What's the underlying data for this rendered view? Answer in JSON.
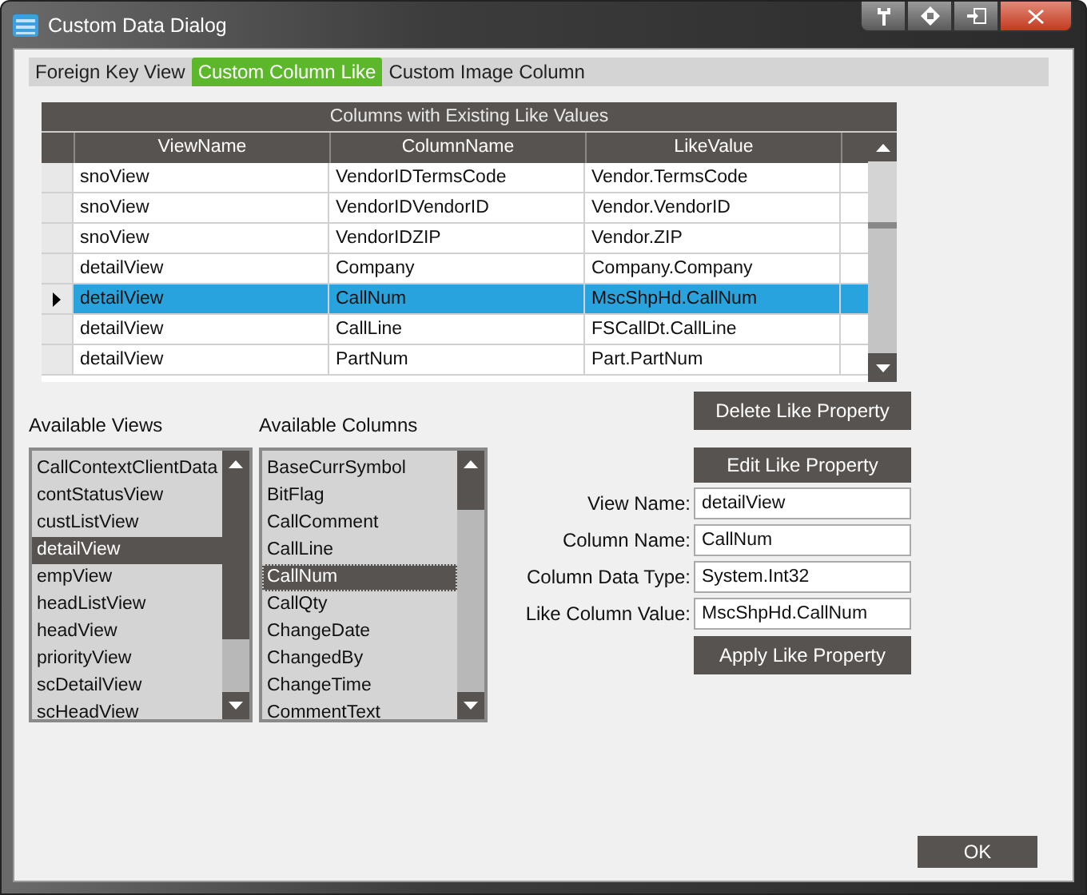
{
  "window": {
    "title": "Custom Data Dialog"
  },
  "tabs": [
    {
      "label": "Foreign Key View",
      "selected": false
    },
    {
      "label": "Custom Column Like",
      "selected": true
    },
    {
      "label": "Custom Image Column",
      "selected": false
    }
  ],
  "grid": {
    "caption": "Columns with Existing Like Values",
    "columns": [
      "ViewName",
      "ColumnName",
      "LikeValue"
    ],
    "rows": [
      {
        "cells": [
          "snoView",
          "VendorIDTermsCode",
          "Vendor.TermsCode"
        ],
        "selected": false
      },
      {
        "cells": [
          "snoView",
          "VendorIDVendorID",
          "Vendor.VendorID"
        ],
        "selected": false
      },
      {
        "cells": [
          "snoView",
          "VendorIDZIP",
          "Vendor.ZIP"
        ],
        "selected": false
      },
      {
        "cells": [
          "detailView",
          "Company",
          "Company.Company"
        ],
        "selected": false
      },
      {
        "cells": [
          "detailView",
          "CallNum",
          "MscShpHd.CallNum"
        ],
        "selected": true
      },
      {
        "cells": [
          "detailView",
          "CallLine",
          "FSCallDt.CallLine"
        ],
        "selected": false
      },
      {
        "cells": [
          "detailView",
          "PartNum",
          "Part.PartNum"
        ],
        "selected": false
      }
    ]
  },
  "available_views": {
    "label": "Available Views",
    "items": [
      {
        "text": "CallContextClientData",
        "selected": false
      },
      {
        "text": "contStatusView",
        "selected": false
      },
      {
        "text": "custListView",
        "selected": false
      },
      {
        "text": "detailView",
        "selected": true
      },
      {
        "text": "empView",
        "selected": false
      },
      {
        "text": "headListView",
        "selected": false
      },
      {
        "text": "headView",
        "selected": false
      },
      {
        "text": "priorityView",
        "selected": false
      },
      {
        "text": "scDetailView",
        "selected": false
      },
      {
        "text": "scHeadView",
        "selected": false
      }
    ]
  },
  "available_columns": {
    "label": "Available Columns",
    "items": [
      {
        "text": "BaseCurrSymbol",
        "selected": false
      },
      {
        "text": "BitFlag",
        "selected": false
      },
      {
        "text": "CallComment",
        "selected": false
      },
      {
        "text": "CallLine",
        "selected": false
      },
      {
        "text": "CallNum",
        "selected": true
      },
      {
        "text": "CallQty",
        "selected": false
      },
      {
        "text": "ChangeDate",
        "selected": false
      },
      {
        "text": "ChangedBy",
        "selected": false
      },
      {
        "text": "ChangeTime",
        "selected": false
      },
      {
        "text": "CommentText",
        "selected": false
      }
    ]
  },
  "delete_button": "Delete Like Property",
  "edit_button": "Edit Like Property",
  "fields": [
    {
      "label": "View Name:",
      "value": "detailView"
    },
    {
      "label": "Column Name:",
      "value": "CallNum"
    },
    {
      "label": "Column Data Type:",
      "value": "System.Int32"
    },
    {
      "label": "Like Column Value:",
      "value": "MscShpHd.CallNum"
    }
  ],
  "apply_button": "Apply Like Property",
  "ok_button": "OK"
}
